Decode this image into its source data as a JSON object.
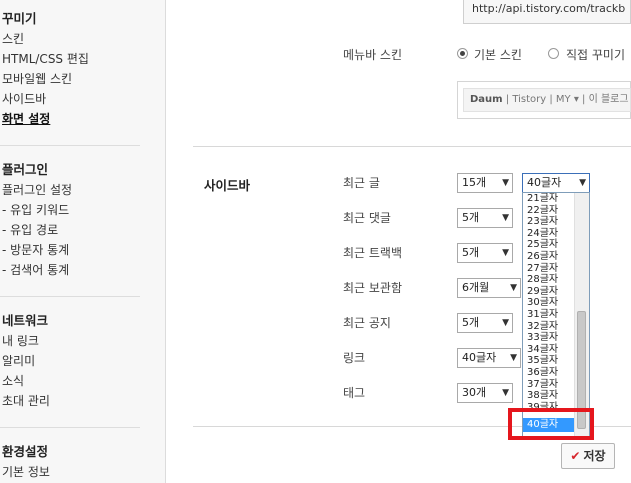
{
  "sidebar": {
    "group_design": {
      "title": "꾸미기",
      "items": [
        "스킨",
        "HTML/CSS 편집",
        "모바일웹 스킨",
        "사이드바",
        "화면 설정"
      ]
    },
    "group_plugin": {
      "title": "플러그인",
      "items": [
        "플러그인 설정",
        "- 유입 키워드",
        "- 유입 경로",
        "- 방문자 통계",
        "- 검색어 통계"
      ]
    },
    "group_network": {
      "title": "네트워크",
      "items": [
        "내 링크",
        "알리미",
        "소식",
        "초대 관리"
      ]
    },
    "group_env": {
      "title": "환경설정",
      "items": [
        "기본 정보"
      ]
    }
  },
  "main": {
    "url_value": "http://api.tistory.com/trackb",
    "menubar_label": "메뉴바 스킨",
    "radio_default": "기본 스킨",
    "radio_custom": "직접 꾸미기",
    "menubar_preview": {
      "brand": "Daum",
      "rest": "| Tistory | MY ▾ | 이 블로그"
    },
    "section_title": "사이드바",
    "rows": [
      {
        "label": "최근 글",
        "count": "15개",
        "chars": "40글자"
      },
      {
        "label": "최근 댓글",
        "count": "5개"
      },
      {
        "label": "최근 트랙백",
        "count": "5개"
      },
      {
        "label": "최근 보관함",
        "count": "6개월"
      },
      {
        "label": "최근 공지",
        "count": "5개"
      },
      {
        "label": "링크",
        "count": "40글자"
      },
      {
        "label": "태그",
        "count": "30개"
      }
    ],
    "dropdown_options": [
      "21글자",
      "22글자",
      "23글자",
      "24글자",
      "25글자",
      "26글자",
      "27글자",
      "28글자",
      "29글자",
      "30글자",
      "31글자",
      "32글자",
      "33글자",
      "34글자",
      "35글자",
      "36글자",
      "37글자",
      "38글자",
      "39글자",
      "40글자"
    ],
    "dropdown_selected": "40글자",
    "save_label": "저장"
  },
  "colors": {
    "accent": "#3399ff",
    "highlight": "#e5161d",
    "check": "#d6262d"
  }
}
